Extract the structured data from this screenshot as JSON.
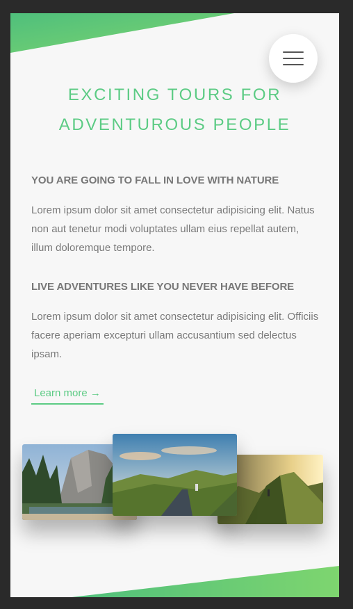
{
  "hero": {
    "title_line1": "EXCITING TOURS FOR",
    "title_line2": "ADVENTUROUS PEOPLE"
  },
  "sections": [
    {
      "heading": "YOU ARE GOING TO FALL IN LOVE WITH NATURE",
      "text": "Lorem ipsum dolor sit amet consectetur adipisicing elit. Natus non aut tenetur modi voluptates ullam eius repellat autem, illum doloremque tempore."
    },
    {
      "heading": "LIVE ADVENTURES LIKE YOU NEVER HAVE BEFORE",
      "text": "Lorem ipsum dolor sit amet consectetur adipisicing elit. Officiis facere aperiam excepturi ullam accusantium sed delectus ipsam."
    }
  ],
  "cta": {
    "label": "Learn more →"
  },
  "menu": {
    "icon": "hamburger-icon"
  },
  "colors": {
    "accent": "#5ccb84",
    "accent_dark": "#28b485",
    "background": "#f7f7f7",
    "frame": "#2a2a2a"
  }
}
